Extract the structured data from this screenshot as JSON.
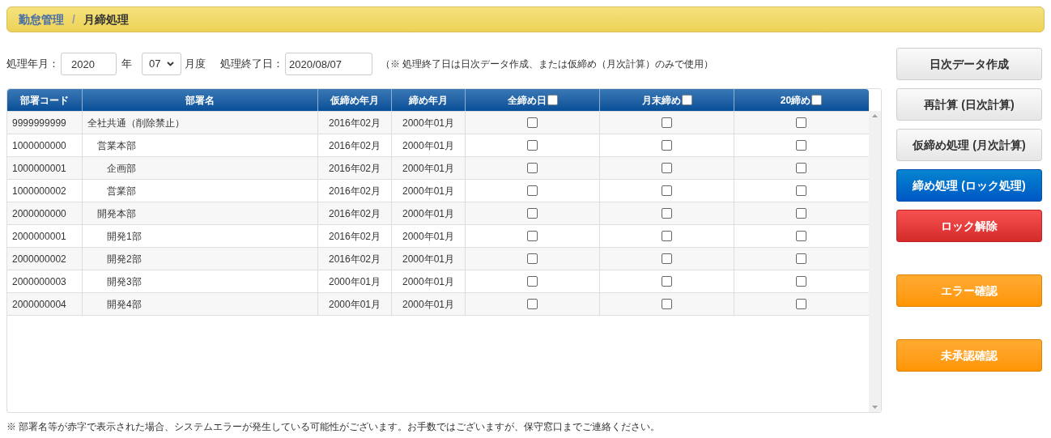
{
  "breadcrumb": {
    "parent": "勤怠管理",
    "separator": "/",
    "current": "月締処理"
  },
  "form": {
    "year_label": "処理年月：",
    "year": "2020",
    "year_unit": "年",
    "month": "07",
    "month_unit": "月度",
    "end_label": "処理終了日：",
    "end_date": "2020/08/07",
    "note": "（※ 処理終了日は日次データ作成、または仮締め（月次計算）のみで使用）"
  },
  "table": {
    "columns": [
      {
        "label": "部署コード",
        "kind": "text"
      },
      {
        "label": "部署名",
        "kind": "text"
      },
      {
        "label": "仮締め年月",
        "kind": "text"
      },
      {
        "label": "締め年月",
        "kind": "text"
      },
      {
        "label": "全締め日",
        "kind": "check",
        "checked": false
      },
      {
        "label": "月末締め",
        "kind": "check",
        "checked": false
      },
      {
        "label": "20締め",
        "kind": "check",
        "checked": false
      }
    ],
    "rows": [
      {
        "code": "9999999999",
        "name": "全社共通（削除禁止）",
        "kari": "2016年02月",
        "shime": "2000年01月",
        "checks": [
          false,
          false,
          false
        ],
        "children": [
          {
            "code": "1000000000",
            "name": "営業本部",
            "kari": "2016年02月",
            "shime": "2000年01月",
            "checks": [
              false,
              false,
              false
            ],
            "children": [
              {
                "code": "1000000001",
                "name": "企画部",
                "kari": "2016年02月",
                "shime": "2000年01月",
                "checks": [
                  false,
                  false,
                  false
                ]
              },
              {
                "code": "1000000002",
                "name": "営業部",
                "kari": "2016年02月",
                "shime": "2000年01月",
                "checks": [
                  false,
                  false,
                  false
                ]
              }
            ]
          },
          {
            "code": "2000000000",
            "name": "開発本部",
            "kari": "2016年02月",
            "shime": "2000年01月",
            "checks": [
              false,
              false,
              false
            ],
            "children": [
              {
                "code": "2000000001",
                "name": "開発1部",
                "kari": "2016年02月",
                "shime": "2000年01月",
                "checks": [
                  false,
                  false,
                  false
                ]
              },
              {
                "code": "2000000002",
                "name": "開発2部",
                "kari": "2016年02月",
                "shime": "2000年01月",
                "checks": [
                  false,
                  false,
                  false
                ]
              },
              {
                "code": "2000000003",
                "name": "開発3部",
                "kari": "2000年01月",
                "shime": "2000年01月",
                "checks": [
                  false,
                  false,
                  false
                ]
              },
              {
                "code": "2000000004",
                "name": "開発4部",
                "kari": "2000年01月",
                "shime": "2000年01月",
                "checks": [
                  false,
                  false,
                  false
                ]
              }
            ]
          }
        ]
      }
    ]
  },
  "buttons": [
    {
      "label": "日次データ作成",
      "kind": "default"
    },
    {
      "label": "再計算 (日次計算)",
      "kind": "default"
    },
    {
      "label": "仮締め処理 (月次計算)",
      "kind": "default"
    },
    {
      "label": "締め処理 (ロック処理)",
      "kind": "primary"
    },
    {
      "label": "ロック解除",
      "kind": "danger"
    },
    {
      "label": "エラー確認",
      "kind": "warning"
    },
    {
      "label": "未承認確認",
      "kind": "warning"
    }
  ],
  "footer_note": "※ 部署名等が赤字で表示された場合、システムエラーが発生している可能性がございます。お手数ではございますが、保守窓口までご連絡ください。"
}
